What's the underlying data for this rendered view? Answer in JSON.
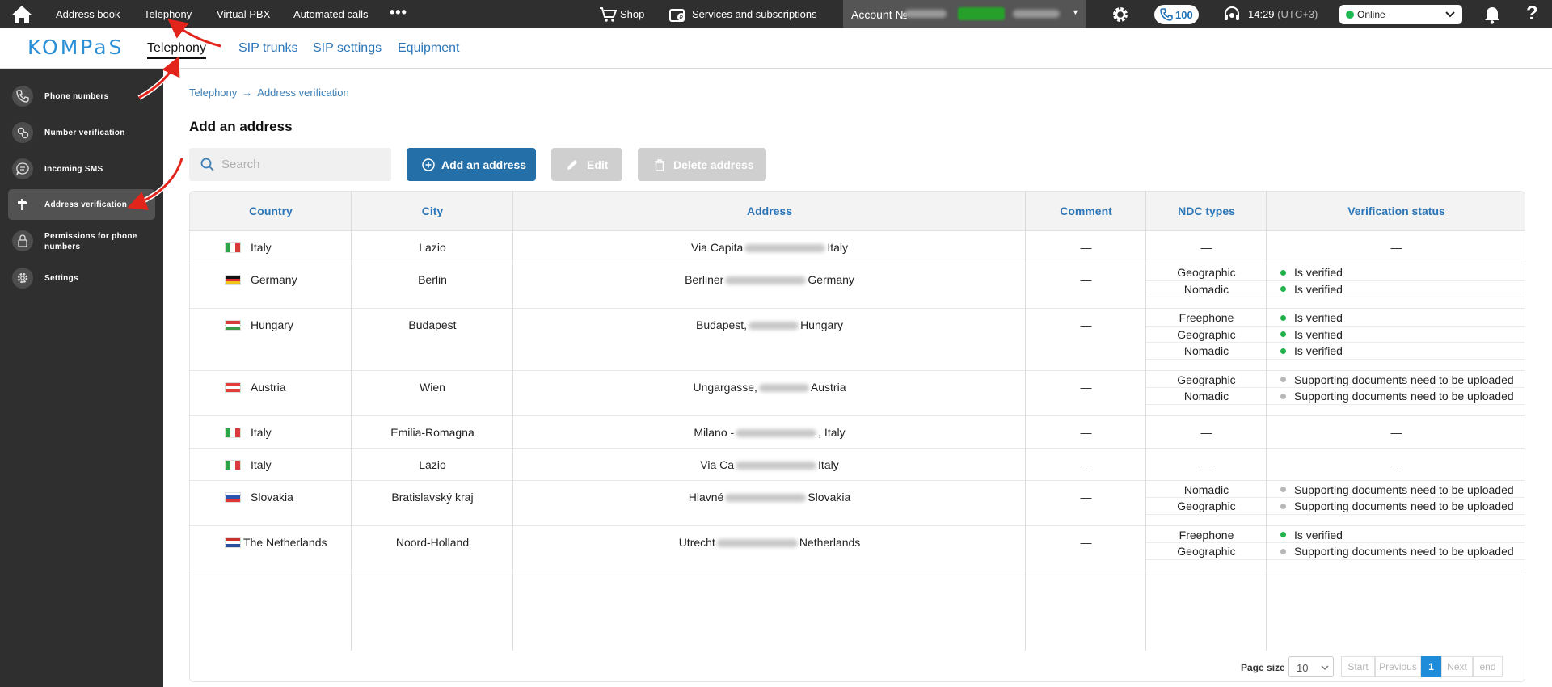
{
  "topbar": {
    "nav": [
      "Address book",
      "Telephony",
      "Virtual PBX",
      "Automated calls"
    ],
    "more": "•••",
    "shop": "Shop",
    "services": "Services and subscriptions",
    "account_label": "Account №",
    "calls_badge": "100",
    "time": "14:29",
    "timezone": "(UTC+3)",
    "status": "Online",
    "help": "?"
  },
  "subhead": {
    "logo": "KOMPaS",
    "tabs": [
      "Telephony",
      "SIP trunks",
      "SIP settings",
      "Equipment"
    ]
  },
  "sidebar": {
    "items": [
      {
        "label": "Phone numbers",
        "icon": "phone-icon"
      },
      {
        "label": "Number verification",
        "icon": "verification-icon"
      },
      {
        "label": "Incoming SMS",
        "icon": "sms-icon"
      },
      {
        "label": "Address verification",
        "icon": "signpost-icon"
      },
      {
        "label": "Permissions for phone numbers",
        "icon": "lock-document-icon"
      },
      {
        "label": "Settings",
        "icon": "gear-icon"
      }
    ]
  },
  "breadcrumb": {
    "root": "Telephony",
    "arrow": "→",
    "current": "Address verification"
  },
  "page_title": "Add an address",
  "toolbar": {
    "search_placeholder": "Search",
    "add_label": "Add an address",
    "edit_label": "Edit",
    "delete_label": "Delete address"
  },
  "table": {
    "columns": [
      "Country",
      "City",
      "Address",
      "Comment",
      "NDC types",
      "Verification status"
    ],
    "rows": [
      {
        "country": "Italy",
        "city": "Lazio",
        "address_pre": "Via Capita",
        "address_post": "Italy",
        "comment": "—",
        "entries": [
          {
            "ndc": "—",
            "status": "—"
          }
        ]
      },
      {
        "country": "Germany",
        "city": "Berlin",
        "address_pre": "Berliner",
        "address_post": "Germany",
        "comment": "—",
        "entries": [
          {
            "ndc": "Geographic",
            "status": "Is verified"
          },
          {
            "ndc": "Nomadic",
            "status": "Is verified"
          }
        ]
      },
      {
        "country": "Hungary",
        "city": "Budapest",
        "address_pre": "Budapest,",
        "address_post": "Hungary",
        "comment": "—",
        "entries": [
          {
            "ndc": "Freephone",
            "status": "Is verified"
          },
          {
            "ndc": "Geographic",
            "status": "Is verified"
          },
          {
            "ndc": "Nomadic",
            "status": "Is verified"
          }
        ]
      },
      {
        "country": "Austria",
        "city": "Wien",
        "address_pre": "Ungargasse,",
        "address_post": "Austria",
        "comment": "—",
        "entries": [
          {
            "ndc": "Geographic",
            "status": "Supporting documents need to be uploaded"
          },
          {
            "ndc": "Nomadic",
            "status": "Supporting documents need to be uploaded"
          }
        ]
      },
      {
        "country": "Italy",
        "city": "Emilia-Romagna",
        "address_pre": "Milano -",
        "address_post": ", Italy",
        "comment": "—",
        "entries": [
          {
            "ndc": "—",
            "status": "—"
          }
        ]
      },
      {
        "country": "Italy",
        "city": "Lazio",
        "address_pre": "Via Ca",
        "address_post": "Italy",
        "comment": "—",
        "entries": [
          {
            "ndc": "—",
            "status": "—"
          }
        ]
      },
      {
        "country": "Slovakia",
        "city": "Bratislavský kraj",
        "address_pre": "Hlavné",
        "address_post": "Slovakia",
        "comment": "—",
        "entries": [
          {
            "ndc": "Nomadic",
            "status": "Supporting documents need to be uploaded"
          },
          {
            "ndc": "Geographic",
            "status": "Supporting documents need to be uploaded"
          }
        ]
      },
      {
        "country": "The Netherlands",
        "city": "Noord-Holland",
        "address_pre": "Utrecht",
        "address_post": "Netherlands",
        "comment": "—",
        "entries": [
          {
            "ndc": "Freephone",
            "status": "Is verified"
          },
          {
            "ndc": "Geographic",
            "status": "Supporting documents need to be uploaded"
          }
        ]
      }
    ]
  },
  "pagination": {
    "page_size_label": "Page size",
    "page_size": "10",
    "start": "Start",
    "previous": "Previous",
    "current": "1",
    "next": "Next",
    "end": "end"
  },
  "colors": {
    "accent": "#246fa8",
    "verified": "#21b14b",
    "pending": "#b8b8b8",
    "annotation_arrow": "#e3241b"
  }
}
